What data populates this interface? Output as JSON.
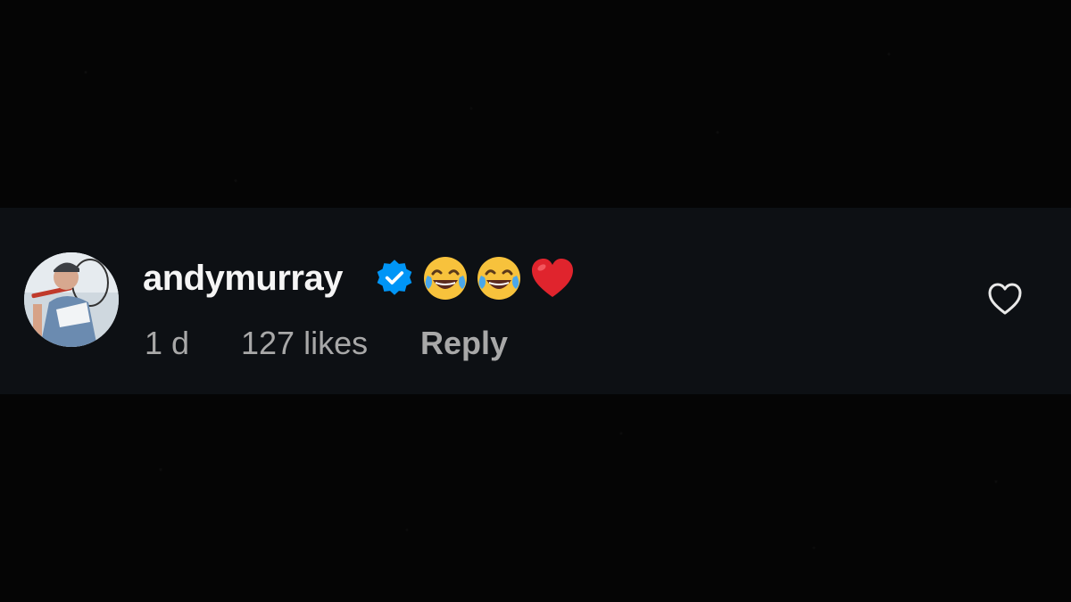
{
  "comment": {
    "username": "andymurray",
    "verified": true,
    "text_emojis": [
      "face-with-tears-of-joy",
      "face-with-tears-of-joy",
      "red-heart"
    ],
    "timestamp": "1 d",
    "likes": "127 likes",
    "reply_label": "Reply",
    "like_icon": "heart-outline-icon"
  },
  "colors": {
    "background": "#050505",
    "comment_background": "#0d1014",
    "username": "#f5f5f5",
    "meta_text": "#a8a8a8",
    "verified_badge": "#0095f6"
  }
}
